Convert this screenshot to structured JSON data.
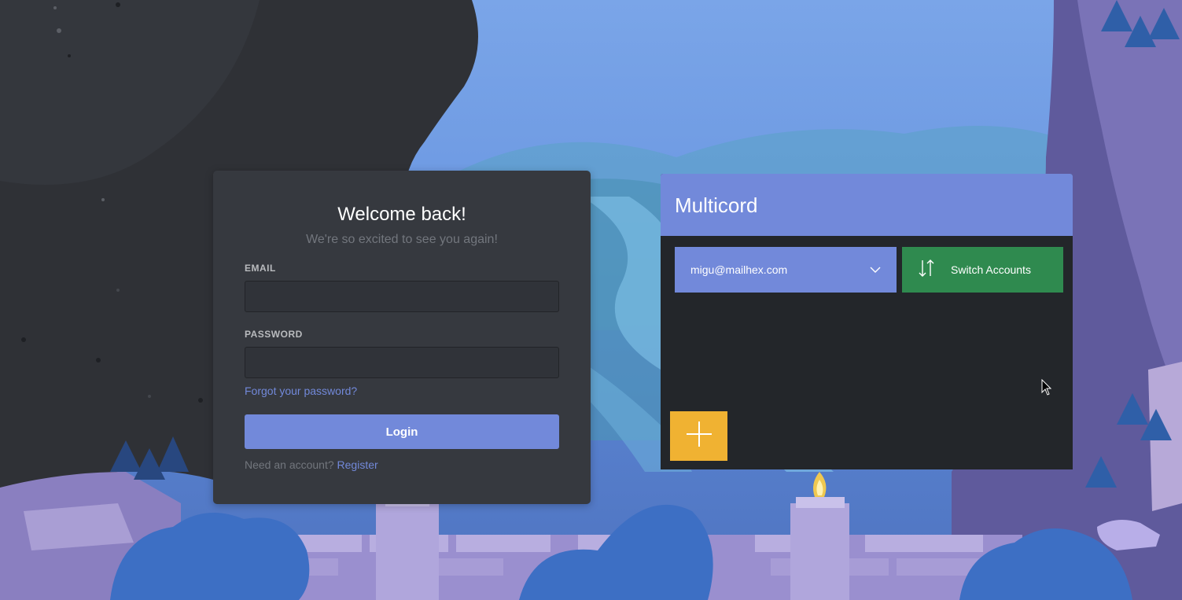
{
  "login": {
    "title": "Welcome back!",
    "subtitle": "We're so excited to see you again!",
    "email_label": "EMAIL",
    "email_value": "",
    "password_label": "PASSWORD",
    "password_value": "",
    "forgot_link": "Forgot your password?",
    "login_button": "Login",
    "register_prompt": "Need an account?",
    "register_link": "Register"
  },
  "multicord": {
    "title": "Multicord",
    "selected_account": "migu@mailhex.com",
    "switch_button": "Switch Accounts",
    "add_button_icon": "plus-icon"
  },
  "colors": {
    "card_bg": "#36393f",
    "blurple": "#7289da",
    "panel_bg": "#23262a",
    "switch_green": "#2f8a4f",
    "add_yellow": "#f0b232"
  }
}
